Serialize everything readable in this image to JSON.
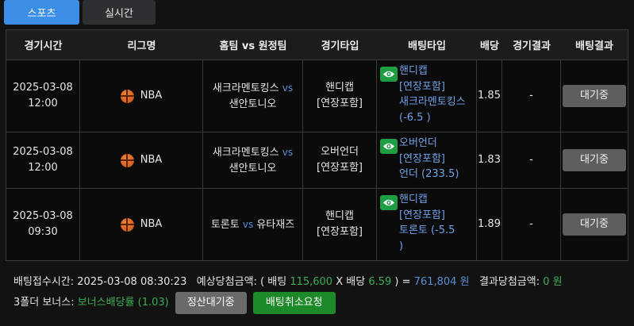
{
  "tabs": [
    {
      "label": "스포츠",
      "active": true
    },
    {
      "label": "실시간",
      "active": false
    }
  ],
  "table": {
    "headers": [
      "경기시간",
      "리그명",
      "홈팀 vs 원정팀",
      "경기타입",
      "배팅타입",
      "배당",
      "경기결과",
      "배팅결과"
    ],
    "rows": [
      {
        "date": "2025-03-08",
        "time": "12:00",
        "league": "NBA",
        "home": "새크라멘토킹스",
        "vs": "vs",
        "away": "샌안토니오",
        "game_type_1": "핸디캡",
        "game_type_2": "[연장포함]",
        "bet_type_lines": [
          "핸디캡",
          "[연장포함]",
          "새크라멘토킹스",
          "(-6.5 )"
        ],
        "odds": "1.85",
        "result": "-",
        "status": "대기중"
      },
      {
        "date": "2025-03-08",
        "time": "12:00",
        "league": "NBA",
        "home": "새크라멘토킹스",
        "vs": "vs",
        "away": "샌안토니오",
        "game_type_1": "오버언더",
        "game_type_2": "[연장포함]",
        "bet_type_lines": [
          "오버언더",
          "[연장포함]",
          "언더 (233.5)"
        ],
        "odds": "1.83",
        "result": "-",
        "status": "대기중"
      },
      {
        "date": "2025-03-08",
        "time": "09:30",
        "league": "NBA",
        "home": "토론토",
        "vs": "vs",
        "away": "유타재즈",
        "game_type_1": "핸디캡",
        "game_type_2": "[연장포함]",
        "bet_type_lines": [
          "핸디캡",
          "[연장포함]",
          "토론토 (-5.5",
          ")"
        ],
        "odds": "1.89",
        "result": "-",
        "status": "대기중"
      }
    ]
  },
  "footer": {
    "accept_time_label": "배팅접수시간:",
    "accept_time": "2025-03-08 08:30:23",
    "expected_label": "예상당첨금액: ( 배팅",
    "bet_amount": "115,600",
    "x_odds_label": "X 배당",
    "total_odds": "6.59",
    "close_eq": ") =",
    "expected_amount": "761,804",
    "won": "원",
    "result_label": "결과당첨금액:",
    "result_amount": "0",
    "result_won": "원",
    "bonus_label": "3폴더 보너스:",
    "bonus_value": "보너스배당률 (1.03)",
    "btn_settle": "정산대기중",
    "btn_cancel": "배팅취소요청"
  },
  "colors": {
    "active_tab": "#3d8ee6",
    "link_blue": "#6fa2e8",
    "green": "#3dae52",
    "eye_badge": "#1e9e43",
    "wait_button": "#5e5e5e"
  }
}
